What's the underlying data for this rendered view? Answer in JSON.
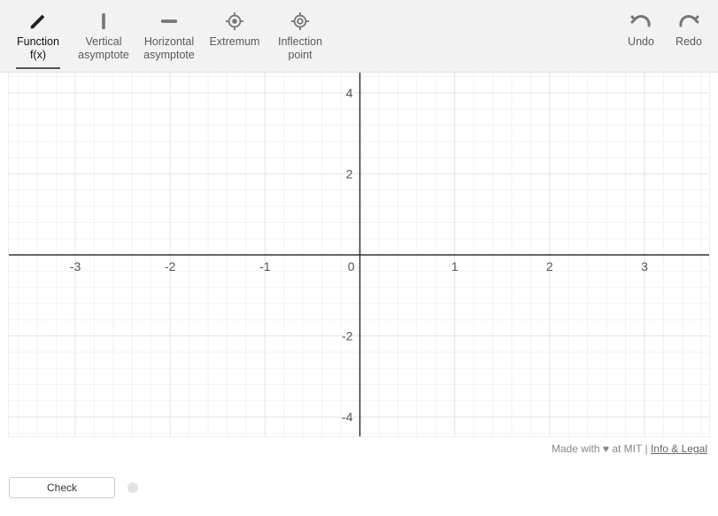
{
  "toolbar": {
    "tools": [
      {
        "id": "function",
        "label": "Function\nf(x)",
        "active": true
      },
      {
        "id": "vasymptote",
        "label": "Vertical\nasymptote",
        "active": false
      },
      {
        "id": "hasymptote",
        "label": "Horizontal\nasymptote",
        "active": false
      },
      {
        "id": "extremum",
        "label": "Extremum",
        "active": false
      },
      {
        "id": "inflection",
        "label": "Inflection\npoint",
        "active": false
      }
    ],
    "history": [
      {
        "id": "undo",
        "label": "Undo"
      },
      {
        "id": "redo",
        "label": "Redo"
      }
    ]
  },
  "footer": {
    "made_with": "Made with ♥ at MIT",
    "separator": " | ",
    "link_label": "Info & Legal"
  },
  "controls": {
    "check_label": "Check"
  },
  "chart_data": {
    "type": "scatter",
    "title": "",
    "xlabel": "",
    "ylabel": "",
    "xlim": [
      -3.7,
      3.7
    ],
    "ylim": [
      -4.5,
      4.5
    ],
    "x_ticks": [
      -3,
      -2,
      -1,
      0,
      1,
      2,
      3
    ],
    "y_ticks": [
      -4,
      -2,
      0,
      2,
      4
    ],
    "grid": true,
    "series": []
  }
}
